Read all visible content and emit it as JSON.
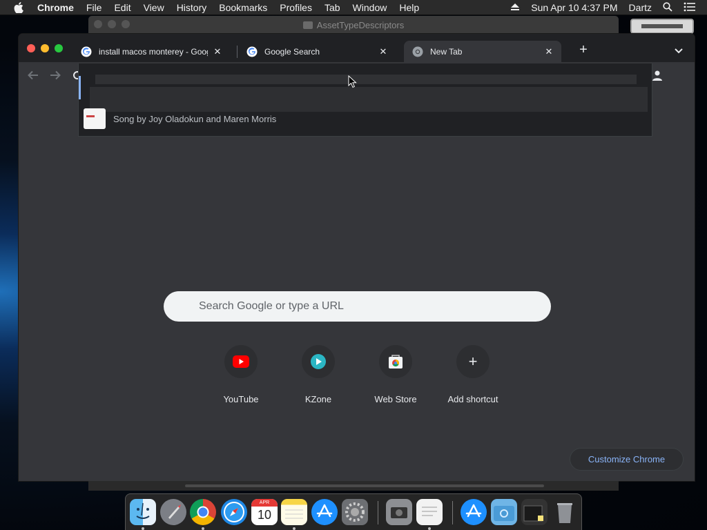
{
  "menubar": {
    "app_name": "Chrome",
    "items": [
      "File",
      "Edit",
      "View",
      "History",
      "Bookmarks",
      "Profiles",
      "Tab",
      "Window",
      "Help"
    ],
    "clock": "Sun Apr 10  4:37 PM",
    "user": "Dartz"
  },
  "background_window": {
    "title": "AssetTypeDescriptors"
  },
  "chrome": {
    "tabs": [
      {
        "title": "install macos monterey - Google Search",
        "active": false
      },
      {
        "title": "Google Search",
        "active": false
      },
      {
        "title": "New Tab",
        "active": true
      }
    ],
    "new_tab_symbol": "+",
    "close_symbol": "✕"
  },
  "omnibox_dropdown": {
    "suggestion_subtitle": "Song by Joy Oladokun and Maren Morris"
  },
  "ntp": {
    "search_placeholder": "Search Google or type a URL",
    "shortcuts": [
      {
        "label": "YouTube",
        "icon": "youtube-icon"
      },
      {
        "label": "KZone",
        "icon": "kzone-icon"
      },
      {
        "label": "Web Store",
        "icon": "web-store-icon"
      },
      {
        "label": "Add shortcut",
        "icon": "plus-icon"
      }
    ],
    "customize_label": "Customize Chrome",
    "add_symbol": "+"
  },
  "calendar_icon": {
    "month": "APR",
    "day": "10"
  },
  "dock": {
    "icons": [
      "finder-icon",
      "launchpad-icon",
      "chrome-icon",
      "safari-icon",
      "calendar-icon",
      "notes-icon",
      "app-store-icon",
      "system-preferences-icon",
      "screenshot-icon",
      "textedit-icon",
      "app-store-folder-icon",
      "downloads-folder-icon",
      "stack-icon",
      "trash-icon"
    ]
  },
  "colors": {
    "accent": "#8ab4f8",
    "tabstrip": "#202124",
    "toolbar": "#35363a",
    "youtube_red": "#ff0000"
  }
}
